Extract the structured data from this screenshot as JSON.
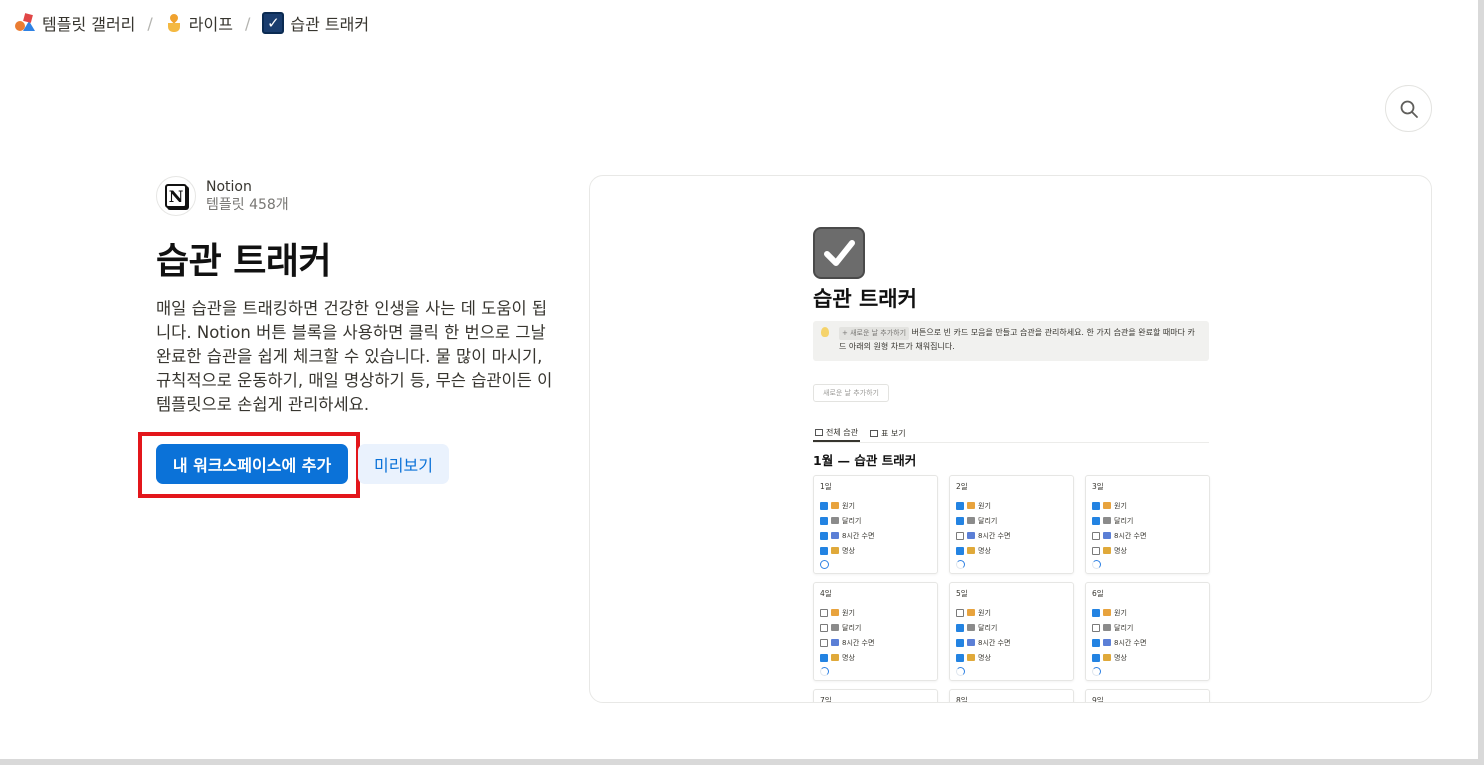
{
  "breadcrumb": {
    "gallery": "템플릿 갤러리",
    "category": "라이프",
    "current": "습관 트래커",
    "separator": "/"
  },
  "creator": {
    "name": "Notion",
    "count": "템플릿 458개",
    "logo_letter": "N"
  },
  "template": {
    "title": "습관 트래커",
    "description": "매일 습관을 트래킹하면 건강한 인생을 사는 데 도움이 됩니다. Notion 버튼 블록을 사용하면 클릭 한 번으로 그날 완료한 습관을 쉽게 체크할 수 있습니다. 물 많이 마시기, 규칙적으로 운동하기, 매일 명상하기 등, 무슨 습관이든 이 템플릿으로 손쉽게 관리하세요.",
    "add_button": "내 워크스페이스에 추가",
    "preview_button": "미리보기"
  },
  "preview": {
    "title": "습관 트래커",
    "callout_chip": "+ 새로운 날 추가하기",
    "callout_text": "버튼으로 빈 카드 모음을 만들고 습관을 관리하세요. 한 가지 습관을 완료할 때마다 카드 아래의 원형 차트가 채워집니다.",
    "new_day_button": "새로운 날 추가하기",
    "tabs": [
      "전체 습관",
      "표 보기"
    ],
    "section_heading": "1월 — 습관 트래커",
    "habits": [
      "원기",
      "달리기",
      "8시간 수면",
      "명상"
    ],
    "habit_colors": [
      "#e8a33d",
      "#8b8b8b",
      "#5b7fd6",
      "#e0a93a"
    ],
    "cards": [
      {
        "day": "1일",
        "checks": [
          true,
          true,
          true,
          true
        ],
        "full": true
      },
      {
        "day": "2일",
        "checks": [
          true,
          true,
          false,
          true
        ],
        "full": false
      },
      {
        "day": "3일",
        "checks": [
          true,
          true,
          false,
          false
        ],
        "full": false
      },
      {
        "day": "4일",
        "checks": [
          false,
          false,
          false,
          true
        ],
        "full": false
      },
      {
        "day": "5일",
        "checks": [
          false,
          true,
          true,
          true
        ],
        "full": false
      },
      {
        "day": "6일",
        "checks": [
          true,
          false,
          true,
          true
        ],
        "full": false
      },
      {
        "day": "7일",
        "checks": [],
        "full": false
      },
      {
        "day": "8일",
        "checks": [],
        "full": false
      },
      {
        "day": "9일",
        "checks": [],
        "full": false
      }
    ]
  },
  "icons": {
    "search": "search-icon",
    "gallery": "template-gallery-icon",
    "category": "life-icon",
    "page": "checkbox-icon"
  }
}
